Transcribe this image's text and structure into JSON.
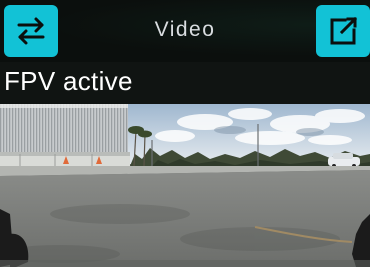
{
  "header": {
    "title": "Video",
    "swap_button_icon": "swap-arrows-icon",
    "popout_button_icon": "open-external-icon"
  },
  "status": {
    "fpv_label": "FPV active"
  },
  "colors": {
    "accent": "#12c2d6",
    "bar_background": "#0b0f0d"
  }
}
